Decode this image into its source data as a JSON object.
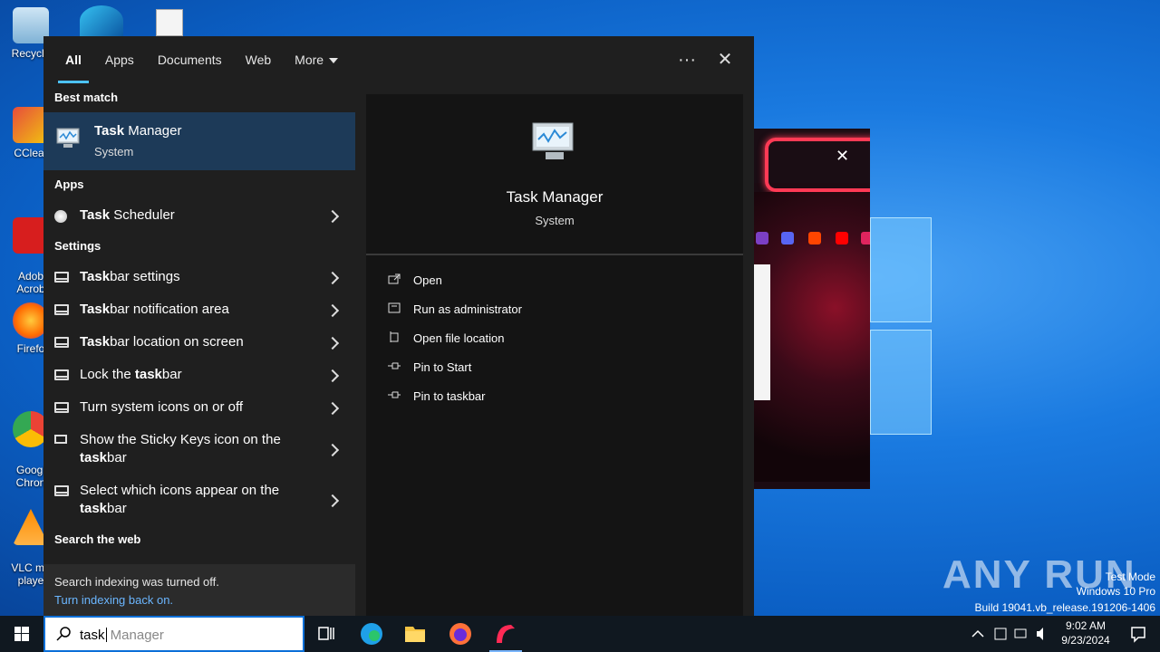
{
  "desktop": {
    "icons": [
      {
        "label": "Recycle"
      },
      {
        "label": "CClear"
      },
      {
        "label": "Adob\nAcrob"
      },
      {
        "label": "Firefo"
      },
      {
        "label": "Googl\nChron"
      },
      {
        "label": "VLC me\nplaye"
      }
    ],
    "watermark": {
      "line1": "Test Mode",
      "line2": "Windows 10 Pro",
      "line3": "Build 19041.vb_release.191206-1406"
    },
    "brand": "ANY RUN"
  },
  "search_panel": {
    "tabs": [
      {
        "label": "All",
        "active": true
      },
      {
        "label": "Apps"
      },
      {
        "label": "Documents"
      },
      {
        "label": "Web"
      },
      {
        "label": "More"
      }
    ],
    "more_options_label": "···",
    "close_label": "✕",
    "best_match_heading": "Best match",
    "best_match": {
      "title_bold": "Task",
      "title_rest": " Manager",
      "subtitle": "System"
    },
    "apps_heading": "Apps",
    "apps": [
      {
        "bold": "Task",
        "rest": " Scheduler"
      }
    ],
    "settings_heading": "Settings",
    "settings": [
      {
        "pre": "",
        "bold": "Task",
        "post": "bar settings"
      },
      {
        "pre": "",
        "bold": "Task",
        "post": "bar notification area"
      },
      {
        "pre": "",
        "bold": "Task",
        "post": "bar location on screen"
      },
      {
        "pre": "Lock the ",
        "bold": "task",
        "post": "bar"
      },
      {
        "pre": "Turn system icons on or off",
        "bold": "",
        "post": ""
      },
      {
        "pre": "Show the Sticky Keys icon on the",
        "bold": "task",
        "post": "bar"
      },
      {
        "pre": "Select which icons appear on the",
        "bold": "task",
        "post": "bar"
      }
    ],
    "web_heading": "Search the web",
    "notice": {
      "text": "Search indexing was turned off.",
      "link": "Turn indexing back on."
    },
    "preview": {
      "title": "Task Manager",
      "subtitle": "System",
      "actions": [
        {
          "label": "Open",
          "icon": "open-icon"
        },
        {
          "label": "Run as administrator",
          "icon": "shield-icon"
        },
        {
          "label": "Open file location",
          "icon": "file-location-icon"
        },
        {
          "label": "Pin to Start",
          "icon": "pin-icon"
        },
        {
          "label": "Pin to taskbar",
          "icon": "pin-icon"
        }
      ]
    }
  },
  "taskbar": {
    "search_typed": "task",
    "search_hint": " Manager",
    "apps": [
      "task-view",
      "edge",
      "file-explorer",
      "firefox",
      "opera"
    ],
    "time": "9:02 AM",
    "date": "9/23/2024"
  },
  "colors": {
    "accent": "#4cc2ff",
    "selected": "#1d3a58",
    "panel": "#1f1f1f",
    "taskbar": "#101820"
  }
}
